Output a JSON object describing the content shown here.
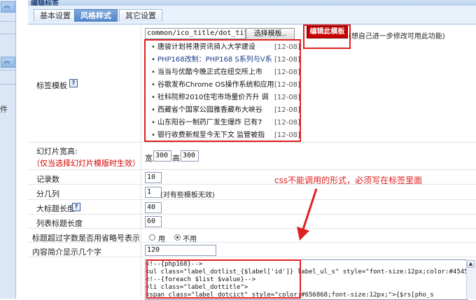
{
  "window": {
    "title": "编辑标签"
  },
  "tabs": [
    {
      "label": "基本设置",
      "active": false
    },
    {
      "label": "风格样式",
      "active": true
    },
    {
      "label": "其它设置",
      "active": false
    }
  ],
  "sidebar": {
    "stub_char": "件"
  },
  "template_row": {
    "path_value": "common/ico_title/dot_title",
    "select_button": "选择模板..",
    "edit_button": "编辑此模板",
    "edit_hint": "(想自己进一步修改可用此功能)"
  },
  "label_template": {
    "label": "标签模板",
    "help": "?"
  },
  "preview_items": [
    {
      "title": "唐骏计划将港资讯骑入大学建设",
      "date": "[12-08]",
      "highlight": false
    },
    {
      "title": "PHP168改制：PHP168 S系列与V系",
      "date": "[12-08]",
      "highlight": true
    },
    {
      "title": "当当与优酷今晚正式在纽交所上市",
      "date": "[12-08]",
      "highlight": false
    },
    {
      "title": "谷歌发布Chrome OS操作系统和应用",
      "date": "[12-08]",
      "highlight": false
    },
    {
      "title": "社科院称2010住宅市场量价齐升 调",
      "date": "[12-08]",
      "highlight": false
    },
    {
      "title": "西藏省个国家公园雅香藏布大峡谷",
      "date": "[12-08]",
      "highlight": false
    },
    {
      "title": "山东阳谷一制药厂发生爆炸 已有7",
      "date": "[12-08]",
      "highlight": false
    },
    {
      "title": "银行收费新规至今无下文 监管被指",
      "date": "[12-08]",
      "highlight": false
    }
  ],
  "slideshow": {
    "label": "幻灯片宽高:",
    "note": "（仅当选择幻灯片模版时生效）",
    "width_label": "宽",
    "width_value": "300",
    "height_label": "高",
    "height_value": "300"
  },
  "rows": {
    "count_label": "记录数",
    "count_value": "10",
    "columns_label": "分几列",
    "columns_value": "1",
    "columns_hint": "(对有些模板无效)",
    "title_len_label": "大标题长度",
    "title_len_help": "?",
    "title_len_value": "40",
    "list_title_len_label": "列表标题长度",
    "list_title_len_value": "60",
    "ellipsis_label": "标题超过字数是否用省略号表示",
    "ellipsis_yes": "用",
    "ellipsis_no": "不用",
    "ellipsis_selected": "no",
    "summary_label": "内容简介显示几个字",
    "summary_value": "120"
  },
  "annotation": {
    "text": "css不能调用的形式，必须写在标签里面",
    "color": "#e02020"
  },
  "code_lines": [
    "<!--{php168}-->",
    "<ul class=\"label_dotlist_{$label['id']} label_ul_s\" style=\"font-size:12px;color:#454545;\">",
    "<!--{foreach $list $value}-->",
    "          <li class=\"label_dottitle\">",
    "                  <span class=\"label_dotcict\" style=\"color:#656868;font-size:12px;\">{$rs[pho_s"
  ]
}
